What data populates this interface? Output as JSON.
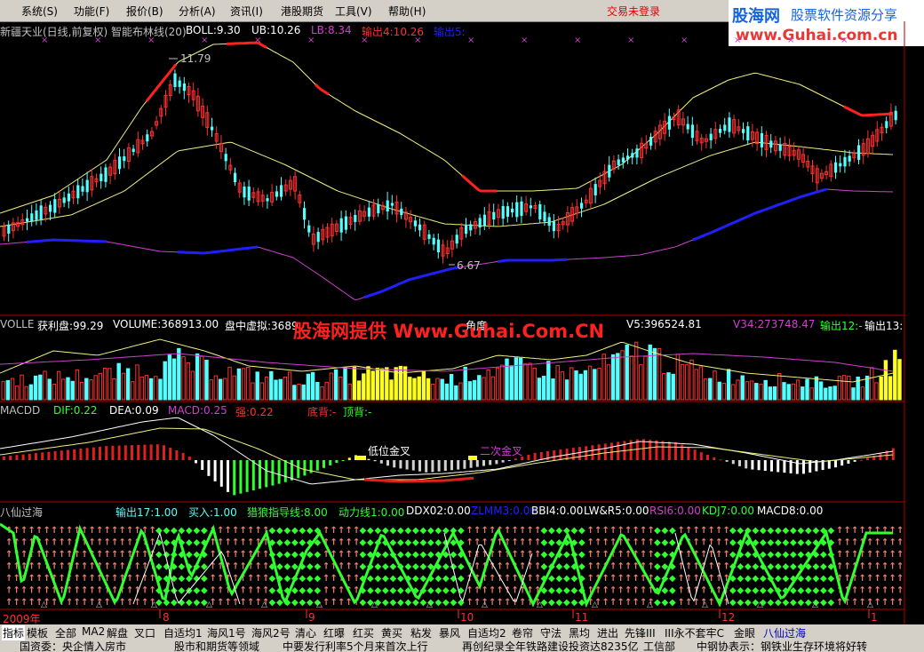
{
  "menu": [
    "系统(S)",
    "功能(F)",
    "报价(B)",
    "分析(A)",
    "资讯(I)",
    "港股期货",
    "工具(V)",
    "帮助(H)"
  ],
  "login_status": "交易未登录",
  "logo": {
    "name": "股海网",
    "slogan": "股票软件资源分享",
    "url": "www.Guhai.com.cn"
  },
  "main_panel": {
    "title": "新疆天业(日线,前复权) 智能布林线(20)",
    "boll": "BOLL:9.30",
    "ub": "UB:10.26",
    "lb": "LB:8.34",
    "out4": "输出4:10.26",
    "out5": "输出5:",
    "high_label": "11.79",
    "low_label": "6.67"
  },
  "volume_panel": {
    "name": "VOLLE",
    "profit": "获利盘:99.29",
    "volume": "VOLUME:368913.00",
    "virtual": "盘中虚拟:3689",
    "angle": "角度",
    "v5": "V5:396524.81",
    "v34": "V34:273748.47",
    "out12": "输出12:-",
    "out13": "输出13:",
    "watermark": "股海网提供 Www.Guhai.Com.CN"
  },
  "macd_panel": {
    "name": "MACDD",
    "dif": "DIF:0.22",
    "dea": "DEA:0.09",
    "macd": "MACD:0.25",
    "strong": "强:0.22",
    "bottom_div": "底背:-",
    "top_div": "顶背:-",
    "low_cross": "低位金叉",
    "second_cross": "二次金叉"
  },
  "baxian_panel": {
    "name": "八仙过海",
    "out17": "输出17:1.00",
    "buy": "买入:1.00",
    "hunter": "猎狼指导线:8.00",
    "power": "动力线1:0.00",
    "ddx": "DDX02:0.00",
    "zlmm": "ZLMM3:0.00",
    "bbi": "BBI4:0.00",
    "lwr": "LW&R5:0.00",
    "rsi": "RSI6:0.00",
    "kdj": "KDJ7:0.00",
    "macd8": "MACD8:0.00"
  },
  "date_axis": [
    "2009年",
    "8",
    "9",
    "10",
    "11",
    "12",
    "1"
  ],
  "bottom_tabs": [
    "指标",
    "模板",
    "全部",
    "MA2",
    "解盘",
    "叉口",
    "自适均1",
    "海风1号",
    "海风2号",
    "清心",
    "红曝",
    "红买",
    "黄买",
    "粘发",
    "暴风",
    "自适均2",
    "卷帘",
    "守法",
    "黑均",
    "进出",
    "先锋III",
    "III永不套牢C",
    "金眼",
    "八仙过海"
  ],
  "active_tab": "八仙过海",
  "ticker": [
    "国资委：央企情入房市",
    "股市和期货等领域",
    "中要发行利率5个月来首次上行",
    "再创纪录全年铁路建设投资达8235亿",
    "工信部",
    "中钢协表示：钢铁业生存环境将好转"
  ],
  "colors": {
    "up": "#ff3030",
    "down": "#54ffff",
    "ma": "#f0f080",
    "lb": "#d040d0",
    "blue": "#2020ff",
    "green": "#30ff30",
    "salmon": "#f08070"
  }
}
